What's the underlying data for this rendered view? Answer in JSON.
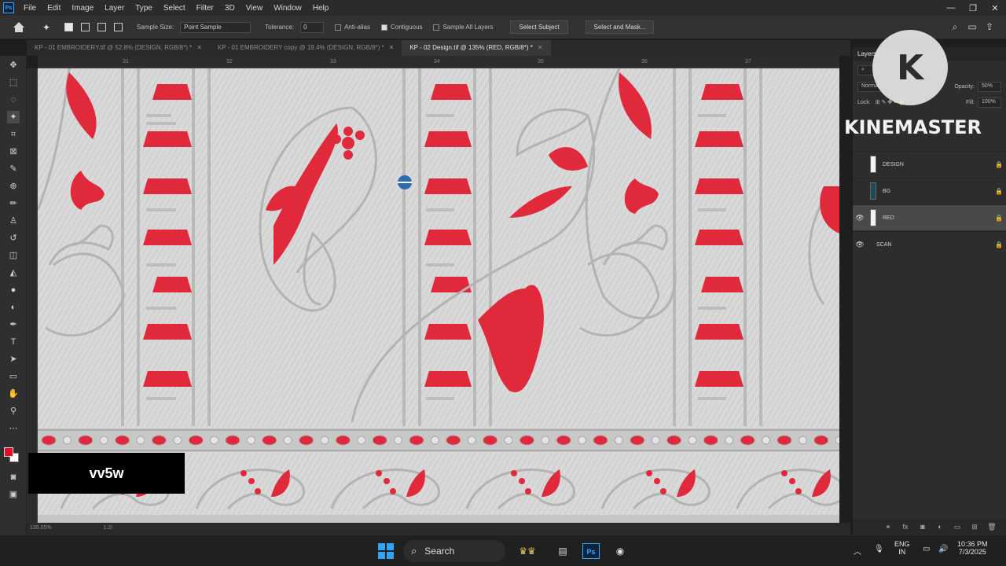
{
  "app": {
    "logo": "Ps"
  },
  "menu": [
    "File",
    "Edit",
    "Image",
    "Layer",
    "Type",
    "Select",
    "Filter",
    "3D",
    "View",
    "Window",
    "Help"
  ],
  "window_controls": [
    "—",
    "❐",
    "✕"
  ],
  "options": {
    "sample_size_label": "Sample Size:",
    "sample_size_value": "Point Sample",
    "tolerance_label": "Tolerance:",
    "tolerance_value": "0",
    "anti_alias": "Anti-alias",
    "contiguous": "Contiguous",
    "sample_all_layers": "Sample All Layers",
    "select_subject": "Select Subject",
    "select_and_mask": "Select and Mask..."
  },
  "tabs": [
    {
      "label": "KP - 01 EMBROIDERY.tif @ 52.8% (DESIGN, RGB/8*) *",
      "active": false
    },
    {
      "label": "KP - 01 EMBROIDERY copy @ 19.4% (DESIGN, RGB/8*) *",
      "active": false
    },
    {
      "label": "KP - 02 Design.tif @ 135% (RED, RGB/8*) *",
      "active": true
    }
  ],
  "ruler_ticks": [
    "31",
    "32",
    "33",
    "34",
    "35",
    "36",
    "37"
  ],
  "status": {
    "zoom": "135.05%",
    "extra": "1.2i"
  },
  "overlay_label": "vv5w",
  "watermark": {
    "logo_letter": "K",
    "brand": "KINEMASTER"
  },
  "layers_panel": {
    "title": "Layers",
    "blend_mode": "Normal",
    "opacity_label": "Opacity:",
    "opacity_value": "50%",
    "lock_label": "Lock:",
    "fill_label": "Fill:",
    "fill_value": "100%",
    "layers": [
      {
        "name": "DESIGN",
        "visible": false,
        "selected": false
      },
      {
        "name": "BG",
        "visible": false,
        "selected": false
      },
      {
        "name": "RED",
        "visible": true,
        "selected": true
      },
      {
        "name": "SCAN",
        "visible": true,
        "selected": false
      }
    ]
  },
  "taskbar": {
    "search_label": "Search",
    "lang_top": "ENG",
    "lang_bottom": "IN",
    "time": "10:36 PM",
    "date": "7/3/2025"
  },
  "colors": {
    "foreground": "#e0102a",
    "background": "#ffffff",
    "embroidery_red": "#e02a3c",
    "fabric": "#d9d9d9"
  }
}
